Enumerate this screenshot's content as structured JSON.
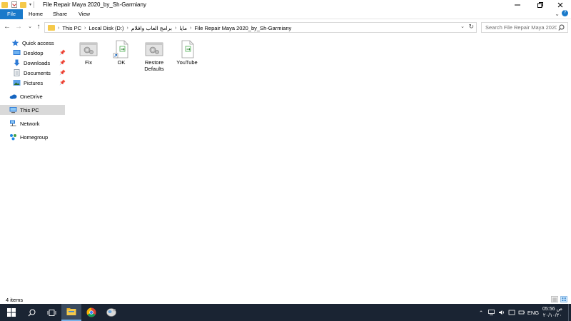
{
  "window": {
    "title": "File Repair Maya 2020_by_Sh-Garmiany",
    "quick_access_toolbar": [
      "folder-icon",
      "properties-icon",
      "new-folder-icon",
      "customize-dropdown-icon"
    ],
    "controls": [
      "minimize-icon",
      "maximize-icon",
      "close-icon"
    ]
  },
  "ribbon": {
    "tabs": [
      "File",
      "Home",
      "Share",
      "View"
    ]
  },
  "address_bar": {
    "breadcrumbs": [
      "This PC",
      "Local Disk (D:)",
      "برامج العاب وافلام",
      "مايا",
      "File Repair Maya 2020_by_Sh-Garmiany"
    ]
  },
  "search": {
    "placeholder": "Search File Repair Maya 2020_..."
  },
  "navigation_pane": {
    "items": [
      {
        "label": "Quick access",
        "icon": "star-icon"
      },
      {
        "label": "Desktop",
        "icon": "desktop-icon",
        "pinned": true
      },
      {
        "label": "Downloads",
        "icon": "download-icon",
        "pinned": true
      },
      {
        "label": "Documents",
        "icon": "documents-icon",
        "pinned": true
      },
      {
        "label": "Pictures",
        "icon": "pictures-icon",
        "pinned": true
      },
      {
        "label": "OneDrive",
        "icon": "cloud-icon"
      },
      {
        "label": "This PC",
        "icon": "computer-icon",
        "selected": true
      },
      {
        "label": "Network",
        "icon": "network-icon"
      },
      {
        "label": "Homegroup",
        "icon": "homegroup-icon"
      }
    ]
  },
  "files": [
    {
      "name": "Fix",
      "icon": "registry-file-icon"
    },
    {
      "name": "OK",
      "icon": "shortcut-file-icon"
    },
    {
      "name": "Restore Defaults",
      "icon": "registry-file-icon"
    },
    {
      "name": "YouTube",
      "icon": "shortcut-file-icon"
    }
  ],
  "status_bar": {
    "item_count": "4 items"
  },
  "taskbar": {
    "pinned": [
      "windows-start-icon",
      "search-icon",
      "task-view-icon",
      "file-explorer-icon",
      "chrome-icon",
      "app-icon"
    ],
    "tray": {
      "language": "ENG",
      "time": "05:56 ص",
      "date": "٢٠/١٠/٢٠"
    }
  },
  "colors": {
    "accent": "#1979ca",
    "selection": "#d9d9d9",
    "taskbar": "#1a2433",
    "folder": "#f5c94a"
  }
}
